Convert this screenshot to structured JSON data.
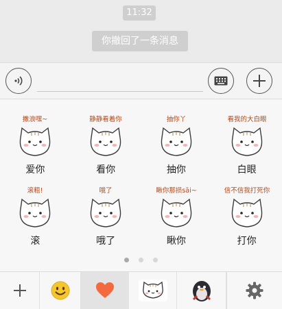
{
  "chat": {
    "time": "11:32",
    "system_message": "你撤回了一条消息"
  },
  "input": {
    "value": "",
    "voice_icon": "voice-icon",
    "keyboard_icon": "keyboard-icon",
    "more_icon": "plus-icon"
  },
  "stickers": [
    {
      "caption": "撒浪嘿~",
      "label": "爱你"
    },
    {
      "caption": "静静看着你",
      "label": "看你"
    },
    {
      "caption": "抽你丫",
      "label": "抽你"
    },
    {
      "caption": "看我的大白眼",
      "label": "白眼"
    },
    {
      "caption": "滚粗!",
      "label": "滚"
    },
    {
      "caption": "哦了",
      "label": "哦了"
    },
    {
      "caption": "瞅你那损sāi~",
      "label": "瞅你"
    },
    {
      "caption": "信不信我打死你",
      "label": "打你"
    }
  ],
  "pager": {
    "pages": 3,
    "active": 1
  },
  "tabs": [
    {
      "icon": "add-icon",
      "selected": false
    },
    {
      "icon": "smiley-icon",
      "selected": false
    },
    {
      "icon": "heart-icon",
      "selected": true
    },
    {
      "icon": "cat-sticker-icon",
      "selected": false
    },
    {
      "icon": "penguin-icon",
      "selected": false
    },
    {
      "icon": "gear-icon",
      "selected": false
    }
  ],
  "colors": {
    "sticker_caption": "#b24b1c",
    "heart": "#f26a3d",
    "smiley": "#f6c62f"
  }
}
